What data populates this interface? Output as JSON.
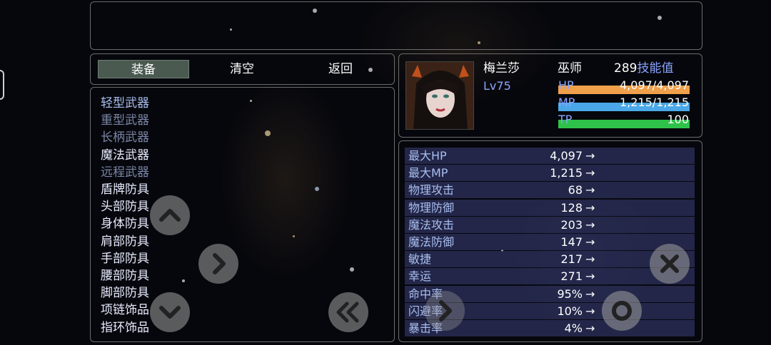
{
  "commands": {
    "equip": "装备",
    "clear": "清空",
    "back": "返回"
  },
  "categories": [
    {
      "label": "轻型武器",
      "state": "on"
    },
    {
      "label": "重型武器",
      "state": "dim"
    },
    {
      "label": "长柄武器",
      "state": "dim"
    },
    {
      "label": "魔法武器",
      "state": "white"
    },
    {
      "label": "远程武器",
      "state": "dim"
    },
    {
      "label": "盾牌防具",
      "state": "white"
    },
    {
      "label": "头部防具",
      "state": "white"
    },
    {
      "label": "身体防具",
      "state": "white"
    },
    {
      "label": "肩部防具",
      "state": "white"
    },
    {
      "label": "手部防具",
      "state": "white"
    },
    {
      "label": "腰部防具",
      "state": "white"
    },
    {
      "label": "脚部防具",
      "state": "white"
    },
    {
      "label": "项链饰品",
      "state": "white"
    },
    {
      "label": "指环饰品",
      "state": "white"
    }
  ],
  "character": {
    "name": "梅兰莎",
    "level_prefix": "Lv",
    "level": "75",
    "class": "巫师",
    "skill_points": "289",
    "skill_points_label": "技能值",
    "hp_label": "HP",
    "hp_value": "4,097/4,097",
    "hp_fraction": 1.0,
    "mp_label": "MP",
    "mp_value": "1,215/1,215",
    "mp_fraction": 1.0,
    "tp_label": "TP",
    "tp_value": "100",
    "tp_fraction": 1.0
  },
  "stats": [
    {
      "name": "最大HP",
      "value": "4,097"
    },
    {
      "name": "最大MP",
      "value": "1,215"
    },
    {
      "name": "物理攻击",
      "value": "68"
    },
    {
      "name": "物理防御",
      "value": "128"
    },
    {
      "name": "魔法攻击",
      "value": "203"
    },
    {
      "name": "魔法防御",
      "value": "147"
    },
    {
      "name": "敏捷",
      "value": "217"
    },
    {
      "name": "幸运",
      "value": "271"
    },
    {
      "name": "命中率",
      "value": "95%"
    },
    {
      "name": "闪避率",
      "value": "10%"
    },
    {
      "name": "暴击率",
      "value": "4%"
    }
  ],
  "arrow_glyph": "→",
  "colors": {
    "hp": "#f0a04a",
    "mp": "#4aa8e8",
    "tp": "#2fc24a",
    "label_blue": "#8aa4ff"
  },
  "virtual_buttons": [
    "up-icon",
    "down-icon",
    "right-icon",
    "double-left-icon",
    "close-icon",
    "confirm-circle-icon"
  ]
}
